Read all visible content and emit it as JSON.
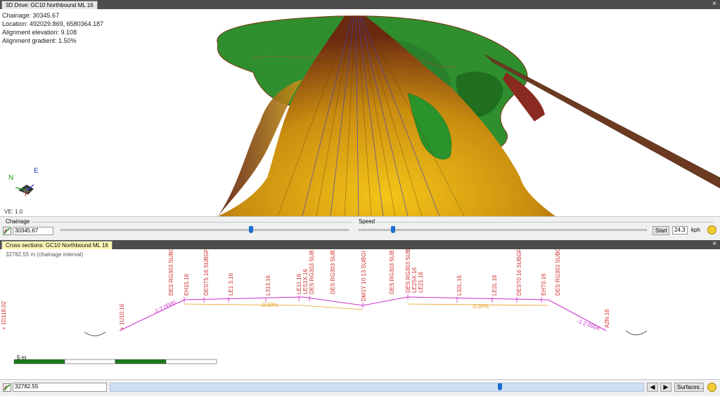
{
  "drive_panel": {
    "title": "3D Drive: GC10 Northbound ML 16",
    "close": "×",
    "info": {
      "chainage": "Chainage: 30345.67",
      "location": "Location: 492029.869, 6580364.187",
      "elevation": "Alignment elevation: 9.108",
      "gradient": "Alignment gradient: 1.50%"
    },
    "compass": {
      "north": "N",
      "east": "E"
    },
    "ve": "VE: 1.0"
  },
  "controls": {
    "chainage_label": "Chainage",
    "chainage_value": "30345.67",
    "chainage_position": 0.66,
    "speed_label": "Speed",
    "speed_position": 0.12,
    "start_label": "Start",
    "speed_value": "24.3",
    "speed_unit": "kph"
  },
  "cross_section_panel": {
    "title": "Cross sections: GC10 Northbound ML 16",
    "close": "×",
    "interval": "32782.55 m (chainage interval)",
    "scale_label": "5 m",
    "labels": [
      "+ 1D118.02",
      "+ 1U10.16",
      "DES RG303 SUBGR",
      "EH15.16",
      "DEST5 16 SUBGF",
      "LE1 3.16",
      "L313.16",
      "LE11.16",
      "LES1X.16",
      "DES RG303 SUB",
      "DES RG303 SUB",
      "DM1Y 10 13 SUBGI",
      "DES RG303 SUB",
      "DES RG303 SUBG",
      "LE2SX.16",
      "LE21.16",
      "L32L.16",
      "LE2L 16",
      "DEST0 16 SUBGF",
      "EHT0.16",
      "DES RG303 SUBGR",
      "A2N.16"
    ],
    "slope_left": "-1:2.0000",
    "slope_right": "-1:2.0004",
    "cross_left": "-3.00%",
    "cross_right": "-3.00%"
  },
  "bottom": {
    "chainage_value": "32782.55",
    "chainage_position": 0.73,
    "prev_label": "◀",
    "next_label": "▶",
    "surfaces_label": "Surfaces..."
  },
  "colors": {
    "terrain_green": "#2e8b2e",
    "road_yellow": "#e0b400",
    "road_brown": "#7a2e10",
    "section_magenta": "#cc2fcc",
    "section_orange": "#e8a020",
    "label_red": "#d03030"
  },
  "icons": [
    "chainage-icon",
    "smiley-icon",
    "compass-icon"
  ]
}
